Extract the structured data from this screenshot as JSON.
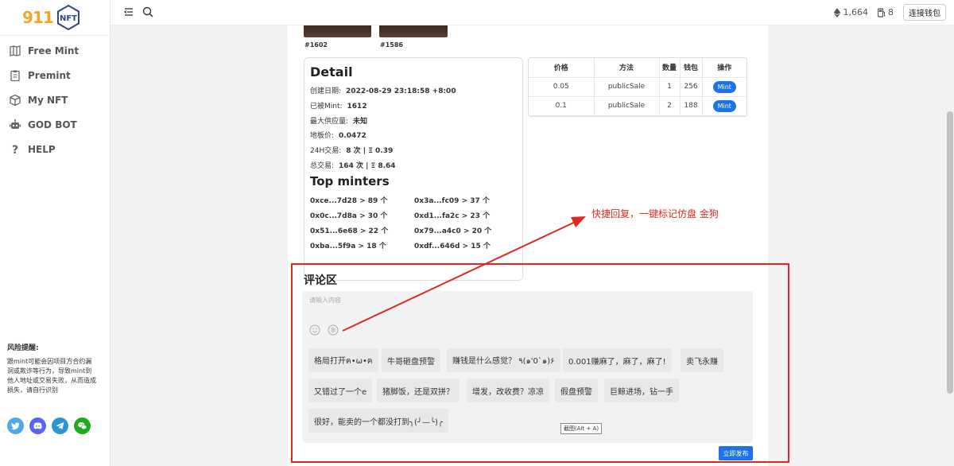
{
  "logo": {
    "number": "911",
    "badge": "NFT"
  },
  "sidebar": {
    "items": [
      {
        "label": "Free Mint",
        "icon": "map-icon"
      },
      {
        "label": "Premint",
        "icon": "clipboard-icon"
      },
      {
        "label": "My NFT",
        "icon": "cube-icon"
      },
      {
        "label": "GOD BOT",
        "icon": "robot-icon"
      },
      {
        "label": "HELP",
        "icon": "question-icon"
      }
    ],
    "risk_title": "风险提醒:",
    "risk_text": "跟mint可能会因项目方合约漏洞或欺诈等行为，导致mint到他人地址或交易失败，从而造成损失，请自行识别",
    "socials": [
      {
        "name": "twitter-icon",
        "color": "#4fa9e8"
      },
      {
        "name": "discord-icon",
        "color": "#5865f2"
      },
      {
        "name": "telegram-icon",
        "color": "#2a94d6"
      },
      {
        "name": "wechat-icon",
        "color": "#1aad19"
      }
    ]
  },
  "topbar": {
    "eth_value": "1,664",
    "gas_value": "8",
    "connect_label": "连接钱包"
  },
  "nfts": [
    {
      "id": "#1602"
    },
    {
      "id": "#1586"
    }
  ],
  "detail": {
    "title": "Detail",
    "rows": [
      {
        "label": "创建日期:",
        "value": "2022-08-29 23:18:58 +8:00"
      },
      {
        "label": "已被Mint:",
        "value": "1612"
      },
      {
        "label": "最大供应量:",
        "value": "未知"
      },
      {
        "label": "地板价:",
        "value": "0.0472"
      },
      {
        "label": "24H交易:",
        "value": "8 次 | Ξ 0.39"
      },
      {
        "label": "总交易:",
        "value": "164 次 | Ξ 8.64"
      }
    ],
    "top_minters_title": "Top minters",
    "minters": [
      "0xce...7d28 > 89 个",
      "0x3a...fc09 > 37 个",
      "0x0c...7d8a > 30 个",
      "0xd1...fa2c > 23 个",
      "0x51...6e68 > 22 个",
      "0x79...a4c0 > 20 个",
      "0xba...5f9a > 18 个",
      "0xdf...646d > 15 个"
    ]
  },
  "mint_table": {
    "headers": [
      "价格",
      "方法",
      "数量",
      "钱包",
      "操作"
    ],
    "rows": [
      {
        "price": "0.05",
        "method": "publicSale",
        "qty": "1",
        "wallets": "256",
        "action": "Mint"
      },
      {
        "price": "0.1",
        "method": "publicSale",
        "qty": "2",
        "wallets": "188",
        "action": "Mint"
      }
    ]
  },
  "comments": {
    "title": "评论区",
    "placeholder": "请输入内容",
    "chips": [
      "格局打开ฅ•ω•ฅ",
      "牛哥砸盘预警",
      "赚钱是什么感觉？ ٩(๑'0`๑)۶",
      "0.001赚麻了，麻了，麻了!",
      "卖飞永赚",
      "又错过了一个e",
      "猪脚饭，还是双拼？",
      "增发，改收费？凉凉",
      "假盘预警",
      "巨鲸进场，钻一手",
      "很好，能卖的一个都没打到╮(╯—╰)╭"
    ],
    "publish_label": "立即发布",
    "tooltip": "截图(Alt + A)"
  },
  "annotation": {
    "text": "快捷回复，一键标记仿盘 金狗",
    "color": "#e0281f"
  }
}
